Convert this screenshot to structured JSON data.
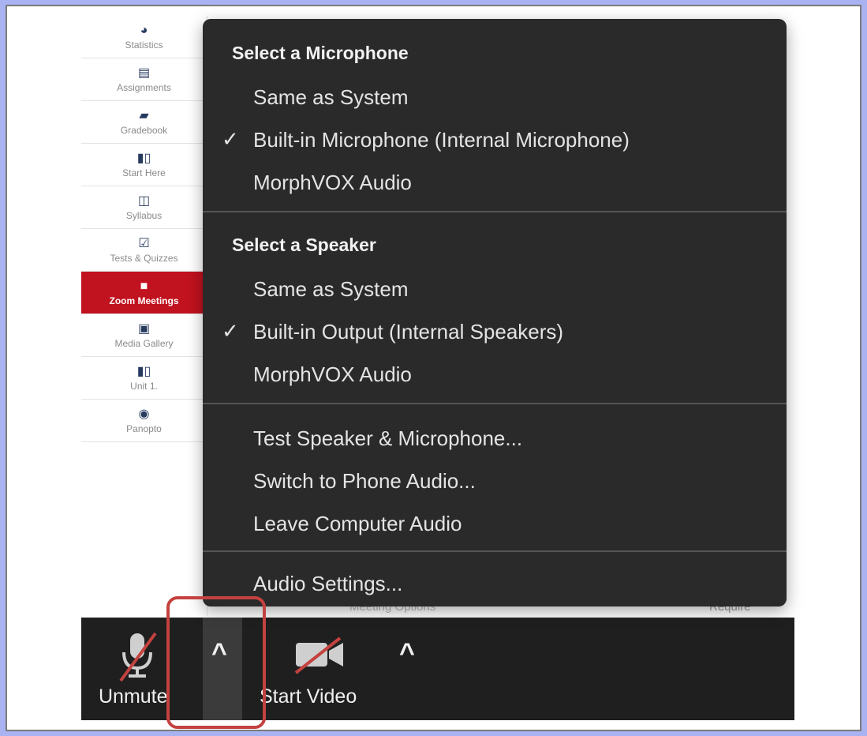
{
  "sidebar": {
    "items": [
      {
        "label": "Statistics",
        "icon": "pie-chart-icon",
        "glyph": "◕"
      },
      {
        "label": "Assignments",
        "icon": "document-icon",
        "glyph": "▤"
      },
      {
        "label": "Gradebook",
        "icon": "book-icon",
        "glyph": "▰"
      },
      {
        "label": "Start Here",
        "icon": "open-book-icon",
        "glyph": "▮▯"
      },
      {
        "label": "Syllabus",
        "icon": "map-icon",
        "glyph": "◫"
      },
      {
        "label": "Tests & Quizzes",
        "icon": "checkbox-icon",
        "glyph": "☑"
      },
      {
        "label": "Zoom Meetings",
        "icon": "video-camera-icon",
        "glyph": "■"
      },
      {
        "label": "Media Gallery",
        "icon": "image-file-icon",
        "glyph": "▣"
      },
      {
        "label": "Unit 1.",
        "icon": "open-book-icon",
        "glyph": "▮▯"
      },
      {
        "label": "Panopto",
        "icon": "panopto-icon",
        "glyph": "◉"
      }
    ]
  },
  "background_content": {
    "bottom_label": "Meeting Options",
    "require_text": "Require"
  },
  "menu": {
    "microphone_heading": "Select a Microphone",
    "microphone_options": [
      "Same as System",
      "Built-in Microphone (Internal Microphone)",
      "MorphVOX Audio"
    ],
    "microphone_selected": "Built-in Microphone (Internal Microphone)",
    "speaker_heading": "Select a Speaker",
    "speaker_options": [
      "Same as System",
      "Built-in Output (Internal Speakers)",
      "MorphVOX Audio"
    ],
    "speaker_selected": "Built-in Output (Internal Speakers)",
    "actions": [
      "Test Speaker & Microphone...",
      "Switch to Phone Audio...",
      "Leave Computer Audio"
    ],
    "settings": "Audio Settings...",
    "check_glyph": "✓"
  },
  "toolbar": {
    "unmute_label": "Unmute",
    "start_video_label": "Start Video",
    "caret_glyph": "^"
  },
  "colors": {
    "active_sidebar": "#c1121f",
    "menu_bg": "#2a2a2b",
    "toolbar_bg": "#1f1f1f",
    "highlight": "#c4423f",
    "page_bg": "#aab3f2"
  }
}
